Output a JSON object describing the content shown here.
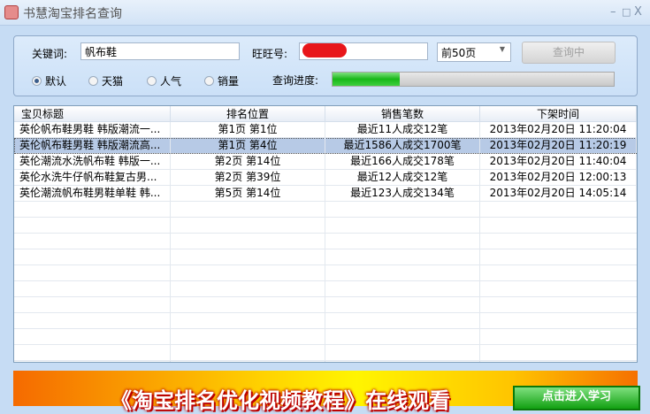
{
  "window": {
    "title": "书慧淘宝排名查询",
    "minimize": "–",
    "maximize": "□",
    "close": "X"
  },
  "form": {
    "keyword_label": "关键词:",
    "keyword_value": "帆布鞋",
    "wangwang_label": "旺旺号:",
    "wangwang_value": "",
    "pages_value": "前50页",
    "query_button": "查询中",
    "progress_label": "查询进度:",
    "progress_percent": 24,
    "sort_options": [
      {
        "label": "默认",
        "selected": true
      },
      {
        "label": "天猫",
        "selected": false
      },
      {
        "label": "人气",
        "selected": false
      },
      {
        "label": "销量",
        "selected": false
      }
    ]
  },
  "table": {
    "columns": [
      "宝贝标题",
      "排名位置",
      "销售笔数",
      "下架时间"
    ],
    "rows": [
      [
        "英伦帆布鞋男鞋 韩版潮流一...",
        "第1页 第1位",
        "最近11人成交12笔",
        "2013年02月20日 11:20:04"
      ],
      [
        "英伦帆布鞋男鞋  韩版潮流高...",
        "第1页 第4位",
        "最近1586人成交1700笔",
        "2013年02月20日 11:20:19"
      ],
      [
        "英伦潮流水洗帆布鞋 韩版一...",
        "第2页 第14位",
        "最近166人成交178笔",
        "2013年02月20日 11:40:04"
      ],
      [
        "英伦水洗牛仔帆布鞋复古男...",
        "第2页 第39位",
        "最近12人成交12笔",
        "2013年02月20日 12:00:13"
      ],
      [
        "英伦潮流帆布鞋男鞋单鞋 韩...",
        "第5页 第14位",
        "最近123人成交134笔",
        "2013年02月20日 14:05:14"
      ]
    ],
    "selected_row": 1
  },
  "banner": {
    "text": "《淘宝排名优化视频教程》在线观看",
    "button": "点击进入学习"
  }
}
